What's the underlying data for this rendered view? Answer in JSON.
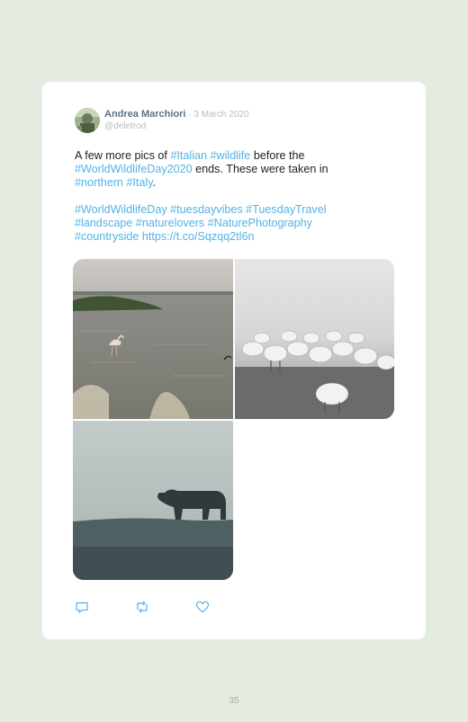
{
  "tweet": {
    "author_name": "Andrea Marchiori",
    "separator": " · ",
    "date": "3 March 2020",
    "handle": "@deletrod",
    "text": {
      "p1_a": "A few more pics of ",
      "tag_italian": "#Italian",
      "space": " ",
      "tag_wildlife": "#wildlife",
      "p1_b": " before the",
      "tag_worldwildlifeday2020": "#WorldWildlifeDay2020",
      "p1_c": " ends. These were taken in",
      "tag_northern": "#northern",
      "tag_italy": "#Italy",
      "period": ".",
      "tag_worldwildlifeday": "#WorldWildlifeDay",
      "tag_tuesdayvibes": "#tuesdayvibes",
      "tag_tuesdaytravel": "#TuesdayTravel",
      "tag_landscape": "#landscape",
      "tag_naturelovers": "#naturelovers",
      "tag_naturephotography": "#NaturePhotography",
      "tag_countryside": "#countryside",
      "link": "https://t.co/Sqzqq2tl6n"
    },
    "actions": [
      {
        "icon": "reply-icon"
      },
      {
        "icon": "retweet-icon"
      },
      {
        "icon": "like-icon"
      }
    ]
  },
  "page": {
    "number": "35"
  },
  "colors": {
    "page_background": "#e4ece2",
    "card_background": "#ffffff",
    "hashtag_link": "#56b1e3",
    "author_name": "#5d7283",
    "muted": "#b2bec8"
  }
}
